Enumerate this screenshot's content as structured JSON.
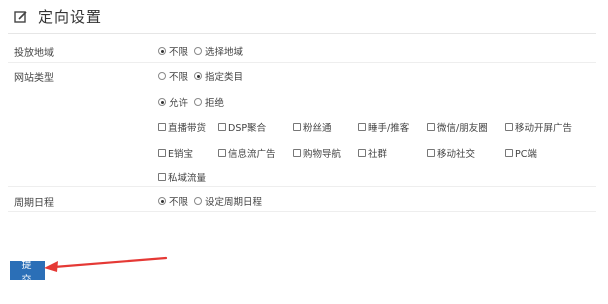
{
  "header": {
    "title": "定向设置"
  },
  "rows": {
    "region": {
      "label": "投放地域",
      "options": [
        "不限",
        "选择地域"
      ]
    },
    "site_type": {
      "label": "网站类型",
      "options": [
        "不限",
        "指定类目"
      ],
      "permit": [
        "允许",
        "拒绝"
      ],
      "categories": [
        "直播带货",
        "DSP聚合",
        "粉丝通",
        "睡手/推客",
        "微信/朋友圈",
        "移动开屏广告",
        "E销宝",
        "信息流广告",
        "购物导航",
        "社群",
        "移动社交",
        "PC端",
        "私域流量"
      ]
    },
    "schedule": {
      "label": "周期日程",
      "options": [
        "不限",
        "设定周期日程"
      ]
    }
  },
  "submit": {
    "label": "提交"
  },
  "colors": {
    "accent": "#2b6fb7",
    "arrow": "#e53935"
  }
}
